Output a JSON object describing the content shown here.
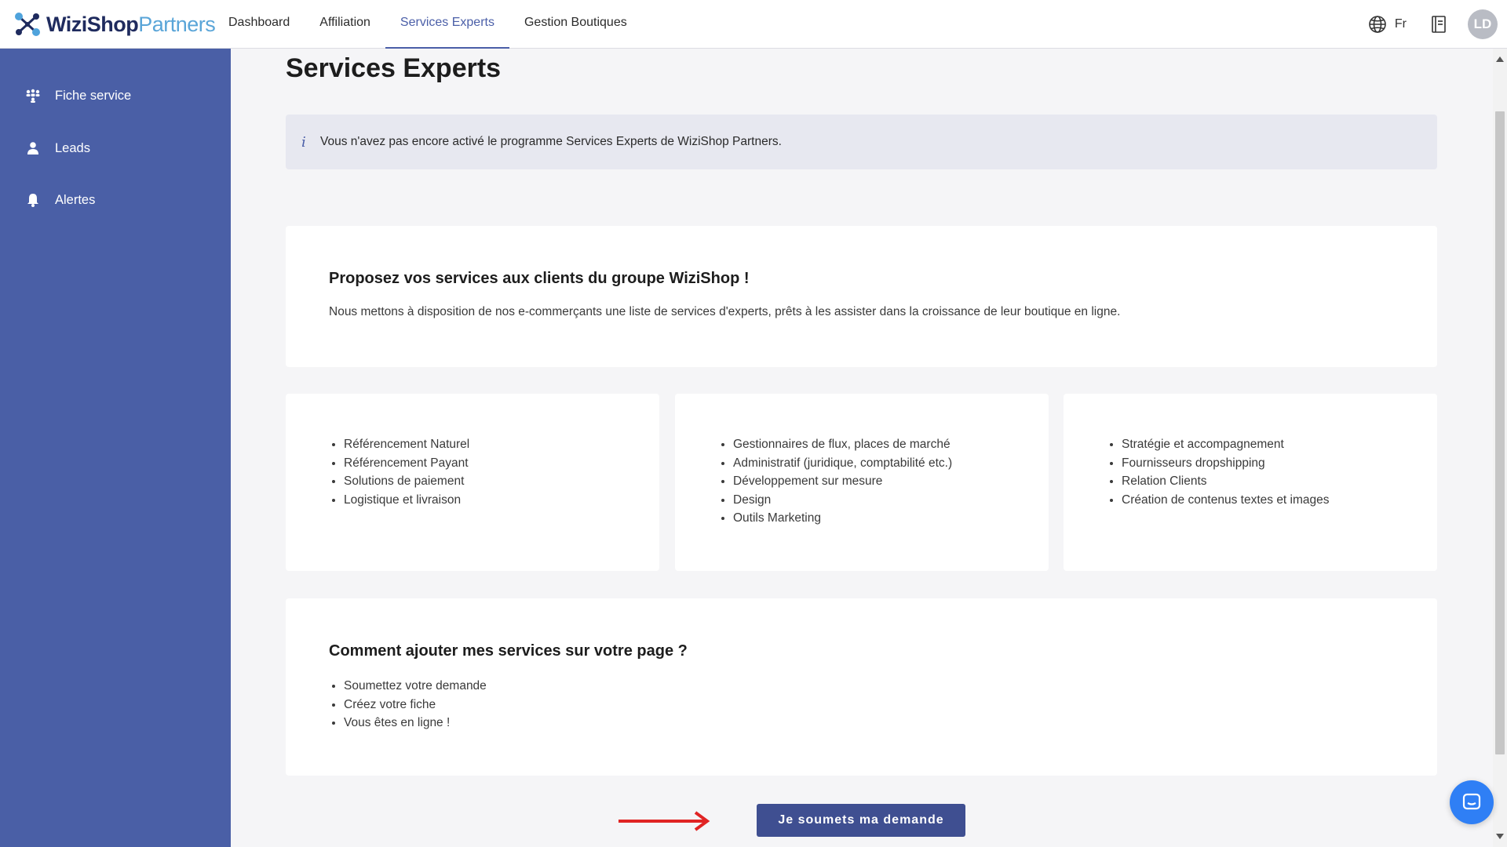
{
  "header": {
    "logo": {
      "brand": "WiziShop",
      "suffix": "Partners"
    },
    "nav": [
      {
        "label": "Dashboard",
        "active": false
      },
      {
        "label": "Affiliation",
        "active": false
      },
      {
        "label": "Services Experts",
        "active": true
      },
      {
        "label": "Gestion Boutiques",
        "active": false
      }
    ],
    "language": "Fr",
    "avatar_initials": "LD"
  },
  "sidebar": {
    "items": [
      {
        "label": "Fiche service",
        "icon": "users-network-icon"
      },
      {
        "label": "Leads",
        "icon": "person-icon"
      },
      {
        "label": "Alertes",
        "icon": "bell-icon"
      }
    ]
  },
  "main": {
    "title": "Services Experts",
    "info": "Vous n'avez pas encore activé le programme Services Experts de WiziShop Partners.",
    "intro": {
      "heading": "Proposez vos services aux clients du groupe WiziShop !",
      "text": "Nous mettons à disposition de nos e-commerçants une liste de services d'experts, prêts à les assister dans la croissance de leur boutique en ligne."
    },
    "service_columns": [
      [
        "Référencement Naturel",
        "Référencement Payant",
        "Solutions de paiement",
        "Logistique et livraison"
      ],
      [
        "Gestionnaires de flux, places de marché",
        "Administratif (juridique, comptabilité etc.)",
        "Développement sur mesure",
        "Design",
        "Outils Marketing"
      ],
      [
        "Stratégie et accompagnement",
        "Fournisseurs dropshipping",
        "Relation Clients",
        "Création de contenus textes et images"
      ]
    ],
    "howto": {
      "heading": "Comment ajouter mes services sur votre page ?",
      "steps": [
        "Soumettez votre demande",
        "Créez votre fiche",
        "Vous êtes en ligne !"
      ]
    },
    "submit_label": "Je soumets ma demande"
  },
  "colors": {
    "sidebar": "#4a5fa6",
    "accent": "#4b5fa8",
    "button": "#3f4f91",
    "arrow": "#e02424",
    "chat": "#2f7ff5"
  }
}
